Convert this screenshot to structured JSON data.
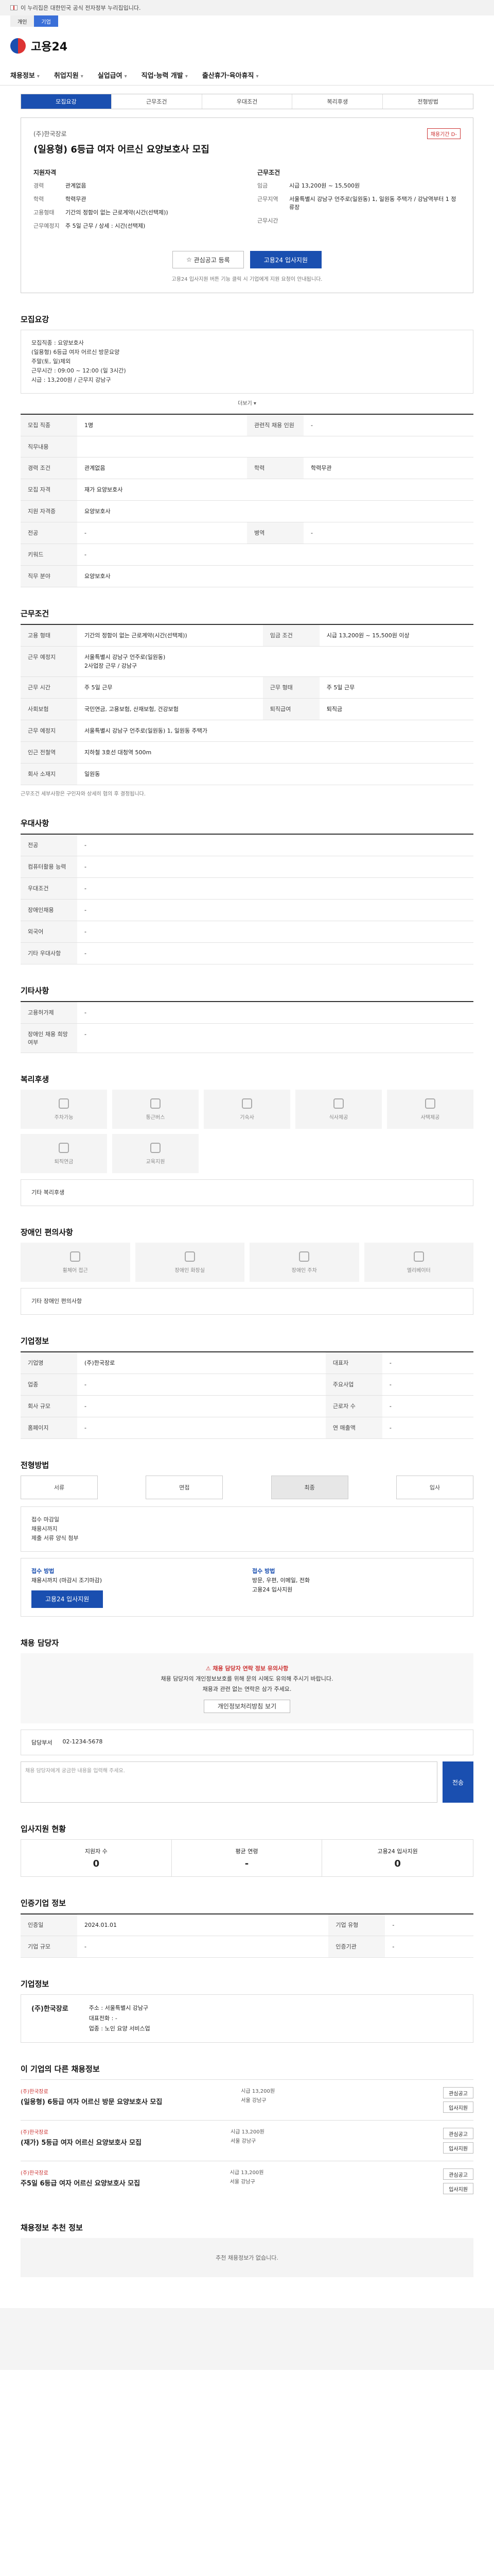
{
  "gov_banner": "이 누리집은 대한민국 공식 전자정부 누리집입니다.",
  "subnav": [
    "개인",
    "기업"
  ],
  "logo": "고용24",
  "gnb": [
    "채용정보",
    "취업지원",
    "실업급여",
    "직업·능력 개발",
    "출산휴가·육아휴직"
  ],
  "tabs": [
    "모집요강",
    "근무조건",
    "우대조건",
    "복리후생",
    "전형방법"
  ],
  "summary": {
    "company": "(주)한국장로",
    "badge": "채용기간 D-",
    "title": "(일용형) 6등급 여자 어르신 요양보호사 모집",
    "left_group": "지원자격",
    "left": [
      {
        "k": "경력",
        "v": "관계없음"
      },
      {
        "k": "학력",
        "v": "학력무관"
      },
      {
        "k": "고용형태",
        "v": "기간의 정함이 없는 근로계약(시간(선택제))"
      },
      {
        "k": "근무예정지",
        "v": "주 5일 근무 / 상세 : 시간(선택제)"
      }
    ],
    "right_group": "근무조건",
    "right": [
      {
        "k": "임금",
        "v": "시급 13,200원 ~ 15,500원"
      },
      {
        "k": "근무지역",
        "v": "서울특별시 강남구 언주로(일원동) 1, 일원동 주택가 / 강남역부터 1 정류장"
      },
      {
        "k": "근무시간",
        "v": ""
      }
    ],
    "btn_save": "관심공고 등록",
    "btn_apply": "고용24 입사지원",
    "note": "고용24 입사지원 버튼 기능 클릭 시 기업에게 지원 요청이 안내됩니다."
  },
  "recruit": {
    "heading": "모집요강",
    "body": "모집직종 : 요양보호사\n(일용형) 6등급 여자 어르신 방문요양\n주말(토, 일)제외\n근무시간 : 09:00 ~ 12:00 (일 3시간)\n시급 : 13,200원 / 근무지 강남구",
    "more": "더보기",
    "rows": [
      {
        "k": "모집 직종",
        "v": "1명",
        "k2": "관련직 채용 인원",
        "v2": "-"
      },
      {
        "k": "직무내용",
        "v": "",
        "k2": "",
        "v2": ""
      },
      {
        "k": "경력 조건",
        "v": "관계없음",
        "k2": "학력",
        "v2": "학력무관"
      },
      {
        "k": "모집 자격",
        "v": "재가 요양보호사",
        "k2": "",
        "v2": ""
      },
      {
        "k": "지원 자격증",
        "v": "요양보호사",
        "k2": "",
        "v2": ""
      },
      {
        "k": "전공",
        "v": "-",
        "k2": "병역",
        "v2": "-"
      },
      {
        "k": "키워드",
        "v": "-",
        "k2": "",
        "v2": ""
      },
      {
        "k": "직무 분야",
        "v": "요양보호사",
        "k2": "",
        "v2": ""
      }
    ]
  },
  "work": {
    "heading": "근무조건",
    "rows": [
      {
        "k": "고용 형태",
        "v": "기간의 정함이 없는 근로계약(시간(선택제))",
        "k2": "임금 조건",
        "v2": "시급 13,200원 ~ 15,500원 이상"
      },
      {
        "k": "근무 예정지",
        "v": "서울특별시 강남구 언주로(일원동)\n2사업장 근무 / 강남구",
        "k2": "",
        "v2": ""
      },
      {
        "k": "근무 시간",
        "v": "주 5일 근무",
        "k2": "근무 형태",
        "v2": "주 5일 근무"
      },
      {
        "k": "사회보험",
        "v": "국민연금, 고용보험, 산재보험, 건강보험",
        "k2": "퇴직급여",
        "v2": "퇴직금"
      },
      {
        "k": "근무 예정지",
        "v": "서울특별시 강남구 언주로(일원동) 1, 일원동 주택가",
        "k2": "",
        "v2": ""
      },
      {
        "k": "인근 전철역",
        "v": "지하철 3호선 대청역 500m",
        "k2": "",
        "v2": ""
      },
      {
        "k": "회사 소재지",
        "v": "일원동",
        "k2": "",
        "v2": ""
      }
    ],
    "caption": "근무조건 세부사항은 구인자와 상세히 협의 후 결정됩니다."
  },
  "prefer": {
    "heading": "우대사항",
    "rows": [
      {
        "k": "전공",
        "v": "-"
      },
      {
        "k": "컴퓨터활용 능력",
        "v": "-"
      },
      {
        "k": "우대조건",
        "v": "-"
      },
      {
        "k": "장애인채용",
        "v": "-"
      },
      {
        "k": "외국어",
        "v": "-"
      },
      {
        "k": "기타 우대사항",
        "v": "-"
      }
    ]
  },
  "etc": {
    "heading": "기타사항",
    "rows": [
      {
        "k": "고용허가제",
        "v": "-"
      },
      {
        "k": "장애인 채용 희망 여부",
        "v": "-"
      }
    ]
  },
  "welfare": {
    "heading": "복리후생",
    "chips": [
      "주차가능",
      "통근버스",
      "기숙사",
      "식사제공",
      "사택제공",
      "퇴직연금",
      "교육지원"
    ],
    "body": "기타 복리후생"
  },
  "disabled": {
    "heading": "장애인 편의사항",
    "chips": [
      "휠체어 접근",
      "장애인 화장실",
      "장애인 주차",
      "엘리베이터"
    ],
    "body": "기타 장애인 편의사항"
  },
  "company_info": {
    "heading": "기업정보",
    "rows": [
      {
        "k": "기업명",
        "v": "(주)한국장로",
        "k2": "대표자",
        "v2": "-"
      },
      {
        "k": "업종",
        "v": "-",
        "k2": "주요사업",
        "v2": "-"
      },
      {
        "k": "회사 규모",
        "v": "-",
        "k2": "근로자 수",
        "v2": "-"
      },
      {
        "k": "홈페이지",
        "v": "-",
        "k2": "연 매출액",
        "v2": "-"
      }
    ]
  },
  "process": {
    "heading": "전형방법",
    "steps": [
      "서류",
      "면접",
      "최종",
      "입사"
    ],
    "body": "접수 마감일\n채용시까지\n제출 서류 양식 첨부",
    "apply_left_title": "접수 방법",
    "apply_left": "채용시까지 (마감시 조기마감)",
    "apply_right_title": "접수 방법",
    "apply_right": "방문, 우편, 이메일, 전화\n고용24 입사지원",
    "btn_apply": "고용24 입사지원"
  },
  "inquiry": {
    "heading": "채용 담당자",
    "warn_title": "채용 담당자 연락 정보 유의사항",
    "warn": "채용 담당자의 개인정보보호를 위해 문의 시에도 유의해 주시기 바랍니다.\n채용과 관련 없는 연락은 삼가 주세요.",
    "btn": "개인정보처리방침 보기",
    "dept": "담당부서",
    "contact": "02-1234-5678",
    "placeholder": "채용 담당자에게 궁금한 내용을 입력해 주세요.",
    "send": "전송"
  },
  "stats": {
    "heading": "입사지원 현황",
    "items": [
      {
        "label": "지원자 수",
        "value": "0"
      },
      {
        "label": "평균 연령",
        "value": "-"
      },
      {
        "label": "고용24 입사지원",
        "value": "0"
      }
    ]
  },
  "manager": {
    "heading": "인증기업 정보",
    "rows": [
      {
        "k": "인증일",
        "v": "2024.01.01",
        "k2": "기업 유형",
        "v2": "-"
      },
      {
        "k": "기업 규모",
        "v": "-",
        "k2": "인증기관",
        "v2": "-"
      }
    ]
  },
  "company_bottom": {
    "heading": "기업정보",
    "name": "(주)한국장로",
    "rows": [
      "주소 : 서울특별시 강남구",
      "대표전화 : -",
      "업종 : 노인 요양 서비스업"
    ]
  },
  "related": {
    "heading": "이 기업의 다른 채용정보",
    "items": [
      {
        "co": "(주)한국장로",
        "title": "(일용형) 6등급 여자 어르신 방문 요양보호사 모집",
        "pay": "시급 13,200원",
        "loc": "서울 강남구",
        "btn1": "관심공고",
        "btn2": "입사지원"
      },
      {
        "co": "(주)한국장로",
        "title": "(재가) 5등급 여자 어르신 요양보호사 모집",
        "pay": "시급 13,200원",
        "loc": "서울 강남구",
        "btn1": "관심공고",
        "btn2": "입사지원"
      },
      {
        "co": "(주)한국장로",
        "title": "주5일 6등급 여자 어르신 요양보호사 모집",
        "pay": "시급 13,200원",
        "loc": "서울 강남구",
        "btn1": "관심공고",
        "btn2": "입사지원"
      }
    ]
  },
  "recommend": {
    "heading": "채용정보 추천 정보",
    "empty": "추천 채용정보가 없습니다."
  }
}
